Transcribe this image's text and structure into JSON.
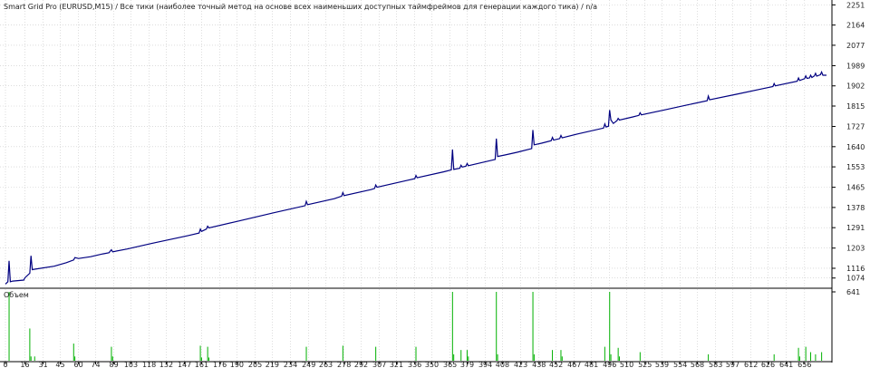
{
  "chart_data": [
    {
      "type": "line",
      "title": "Smart Grid Pro (EURUSD,M15) / Все тики (наиболее точный метод на основе всех наименьших доступных таймфреймов для генерации каждого тика) / n/a",
      "xlabel": "",
      "ylabel": "",
      "grid": true,
      "legend": "none",
      "line_color": "#000080",
      "y_ticks": [
        1074,
        1116,
        1203,
        1291,
        1378,
        1465,
        1553,
        1640,
        1727,
        1815,
        1902,
        1989,
        2077,
        2164,
        2251
      ],
      "ylim": [
        1030,
        2272
      ],
      "xlim": [
        0,
        674
      ],
      "x_ticks": [
        0,
        16,
        31,
        45,
        60,
        74,
        89,
        103,
        118,
        132,
        147,
        161,
        176,
        190,
        205,
        219,
        234,
        249,
        263,
        278,
        292,
        307,
        321,
        336,
        350,
        365,
        379,
        394,
        408,
        423,
        438,
        452,
        467,
        481,
        496,
        510,
        525,
        539,
        554,
        568,
        583,
        597,
        612,
        626,
        641,
        656
      ],
      "points": [
        [
          0,
          1048
        ],
        [
          2,
          1058
        ],
        [
          3,
          1148
        ],
        [
          4,
          1058
        ],
        [
          6,
          1061
        ],
        [
          15,
          1065
        ],
        [
          16,
          1075
        ],
        [
          20,
          1095
        ],
        [
          21,
          1170
        ],
        [
          22,
          1110
        ],
        [
          24,
          1112
        ],
        [
          40,
          1125
        ],
        [
          50,
          1140
        ],
        [
          56,
          1152
        ],
        [
          57,
          1162
        ],
        [
          60,
          1158
        ],
        [
          70,
          1166
        ],
        [
          80,
          1178
        ],
        [
          85,
          1183
        ],
        [
          87,
          1196
        ],
        [
          88,
          1187
        ],
        [
          100,
          1199
        ],
        [
          120,
          1223
        ],
        [
          150,
          1257
        ],
        [
          159,
          1268
        ],
        [
          160,
          1285
        ],
        [
          161,
          1275
        ],
        [
          165,
          1285
        ],
        [
          166,
          1297
        ],
        [
          167,
          1290
        ],
        [
          190,
          1318
        ],
        [
          220,
          1355
        ],
        [
          246,
          1386
        ],
        [
          247,
          1404
        ],
        [
          248,
          1390
        ],
        [
          270,
          1416
        ],
        [
          276,
          1427
        ],
        [
          277,
          1442
        ],
        [
          278,
          1429
        ],
        [
          300,
          1455
        ],
        [
          303,
          1460
        ],
        [
          304,
          1475
        ],
        [
          305,
          1465
        ],
        [
          330,
          1495
        ],
        [
          336,
          1502
        ],
        [
          337,
          1516
        ],
        [
          338,
          1506
        ],
        [
          360,
          1532
        ],
        [
          366,
          1540
        ],
        [
          367,
          1628
        ],
        [
          368,
          1542
        ],
        [
          373,
          1547
        ],
        [
          374,
          1560
        ],
        [
          375,
          1552
        ],
        [
          378,
          1556
        ],
        [
          379,
          1568
        ],
        [
          380,
          1558
        ],
        [
          402,
          1585
        ],
        [
          403,
          1675
        ],
        [
          404,
          1598
        ],
        [
          410,
          1604
        ],
        [
          420,
          1616
        ],
        [
          432,
          1632
        ],
        [
          433,
          1712
        ],
        [
          434,
          1648
        ],
        [
          440,
          1655
        ],
        [
          448,
          1666
        ],
        [
          449,
          1680
        ],
        [
          450,
          1668
        ],
        [
          455,
          1675
        ],
        [
          456,
          1688
        ],
        [
          457,
          1678
        ],
        [
          470,
          1695
        ],
        [
          491,
          1720
        ],
        [
          492,
          1738
        ],
        [
          493,
          1725
        ],
        [
          495,
          1728
        ],
        [
          496,
          1798
        ],
        [
          497,
          1755
        ],
        [
          499,
          1740
        ],
        [
          502,
          1752
        ],
        [
          503,
          1762
        ],
        [
          504,
          1755
        ],
        [
          515,
          1768
        ],
        [
          520,
          1775
        ],
        [
          521,
          1786
        ],
        [
          522,
          1777
        ],
        [
          540,
          1797
        ],
        [
          560,
          1820
        ],
        [
          576,
          1838
        ],
        [
          577,
          1858
        ],
        [
          578,
          1842
        ],
        [
          600,
          1866
        ],
        [
          620,
          1888
        ],
        [
          630,
          1899
        ],
        [
          631,
          1912
        ],
        [
          632,
          1902
        ],
        [
          650,
          1922
        ],
        [
          651,
          1936
        ],
        [
          652,
          1925
        ],
        [
          656,
          1933
        ],
        [
          657,
          1945
        ],
        [
          658,
          1934
        ],
        [
          660,
          1936
        ],
        [
          661,
          1948
        ],
        [
          662,
          1938
        ],
        [
          664,
          1945
        ],
        [
          665,
          1956
        ],
        [
          666,
          1944
        ],
        [
          669,
          1950
        ],
        [
          670,
          1962
        ],
        [
          671,
          1948
        ],
        [
          674,
          1948
        ]
      ]
    },
    {
      "type": "bar",
      "title": "Объем",
      "xlabel": "",
      "ylabel": "",
      "y_ticks": [
        641
      ],
      "ylim": [
        0,
        641
      ],
      "grid": true,
      "bar_color": "#00b000",
      "bars": [
        [
          3,
          641
        ],
        [
          20,
          300
        ],
        [
          21,
          40
        ],
        [
          24,
          40
        ],
        [
          56,
          160
        ],
        [
          57,
          40
        ],
        [
          87,
          130
        ],
        [
          88,
          40
        ],
        [
          160,
          140
        ],
        [
          161,
          30
        ],
        [
          166,
          130
        ],
        [
          167,
          30
        ],
        [
          247,
          130
        ],
        [
          277,
          140
        ],
        [
          304,
          130
        ],
        [
          337,
          130
        ],
        [
          367,
          641
        ],
        [
          368,
          60
        ],
        [
          374,
          100
        ],
        [
          379,
          100
        ],
        [
          380,
          40
        ],
        [
          403,
          641
        ],
        [
          404,
          60
        ],
        [
          433,
          641
        ],
        [
          434,
          60
        ],
        [
          449,
          100
        ],
        [
          456,
          100
        ],
        [
          457,
          40
        ],
        [
          492,
          130
        ],
        [
          496,
          641
        ],
        [
          497,
          60
        ],
        [
          503,
          120
        ],
        [
          504,
          40
        ],
        [
          521,
          80
        ],
        [
          577,
          60
        ],
        [
          631,
          60
        ],
        [
          651,
          120
        ],
        [
          652,
          40
        ],
        [
          657,
          130
        ],
        [
          661,
          80
        ],
        [
          665,
          60
        ],
        [
          670,
          80
        ]
      ]
    }
  ]
}
